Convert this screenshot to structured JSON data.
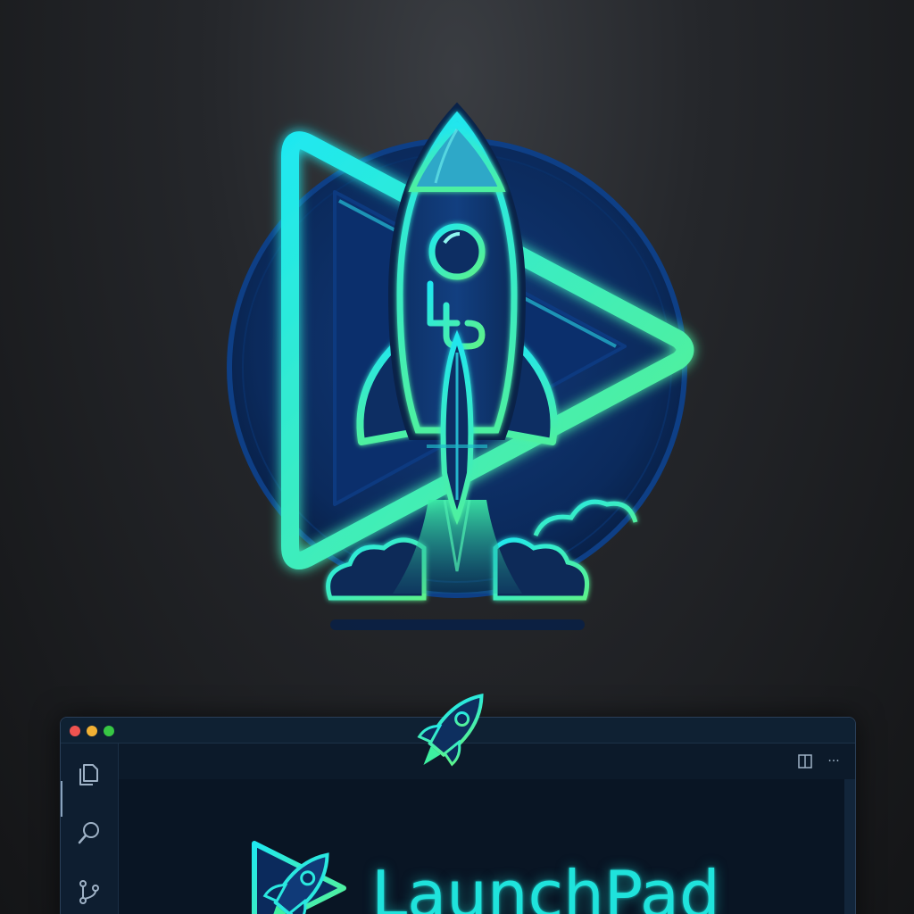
{
  "window": {
    "title_buttons": [
      "close",
      "minimize",
      "zoom"
    ],
    "activity_icons": [
      "explorer-icon",
      "search-icon",
      "source-control-icon"
    ],
    "tab_actions": [
      "split-editor-icon",
      "more-actions-icon"
    ],
    "more_label": "···"
  },
  "brand": {
    "name": "LaunchPad"
  },
  "colors": {
    "accent": "#1fe3dc",
    "accent_green": "#3df0a0",
    "navy": "#0b2a5c",
    "background": "#1f2124"
  }
}
